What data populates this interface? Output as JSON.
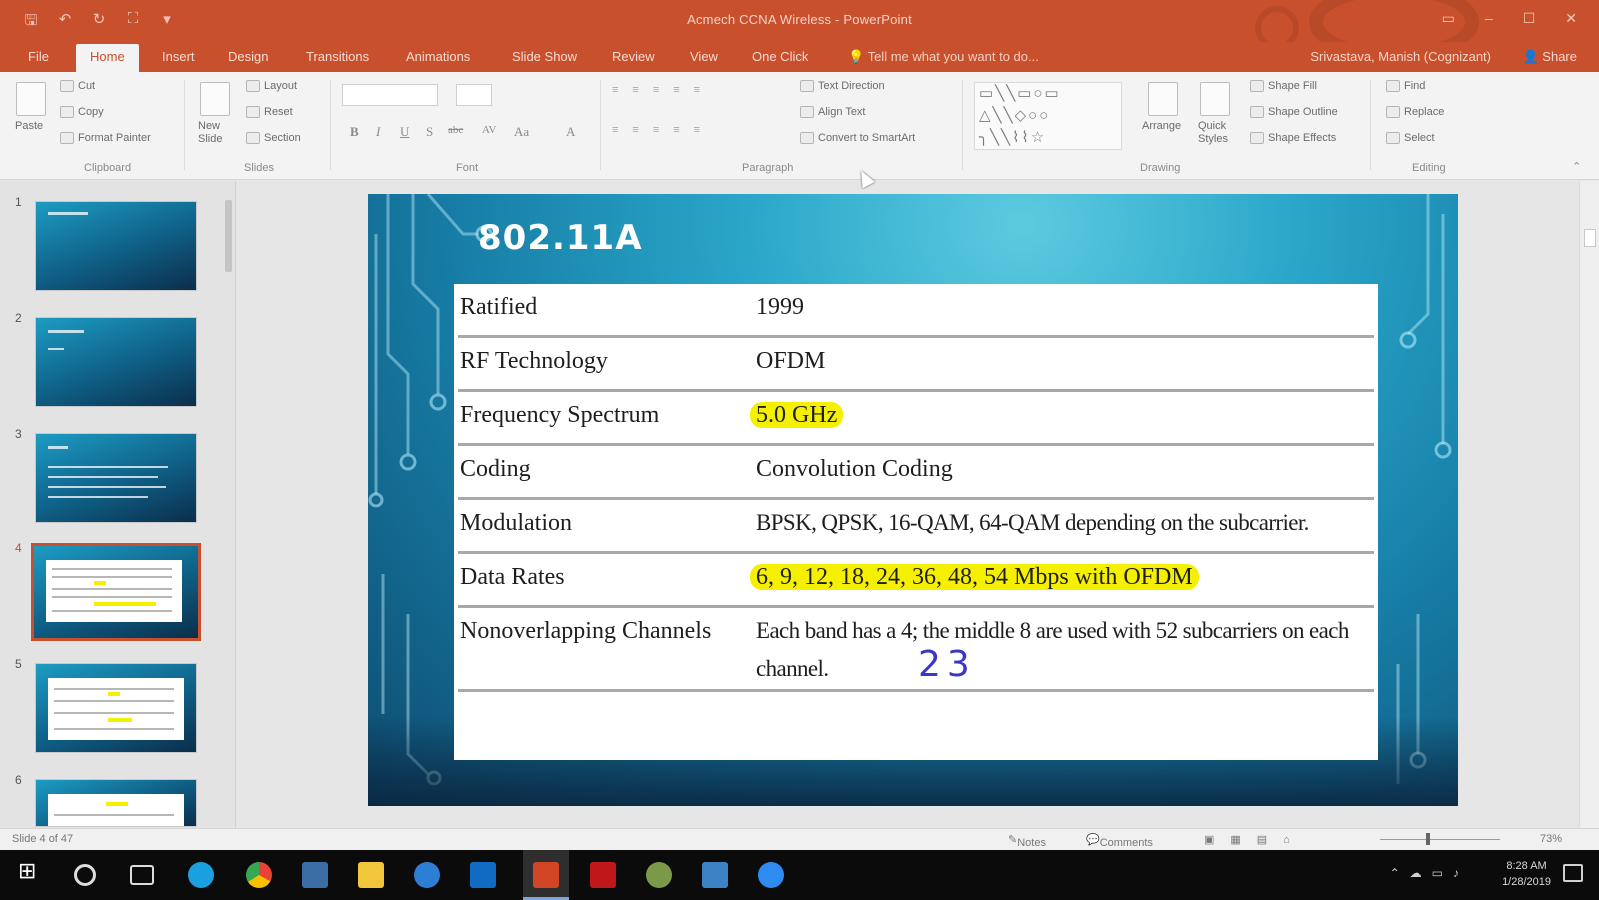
{
  "app": {
    "title": "Acmech CCNA Wireless - PowerPoint",
    "user": "Srivastava, Manish (Cognizant)",
    "share": "Share"
  },
  "qat": {
    "save": "🖫",
    "undo": "↶",
    "redo": "↻",
    "start": "⛶",
    "more": "▾"
  },
  "window_controls": {
    "ribbon_options": "▭",
    "minimize": "–",
    "maximize": "☐",
    "close": "✕"
  },
  "tabs": [
    "File",
    "Home",
    "Insert",
    "Design",
    "Transitions",
    "Animations",
    "Slide Show",
    "Review",
    "View",
    "One Click"
  ],
  "active_tab": "Home",
  "tell_me": "Tell me what you want to do...",
  "ribbon": {
    "clipboard": {
      "paste": "Paste",
      "cut": "Cut",
      "copy": "Copy",
      "format_painter": "Format Painter",
      "label": "Clipboard"
    },
    "slides": {
      "new_slide": "New Slide",
      "layout": "Layout",
      "reset": "Reset",
      "section": "Section",
      "label": "Slides"
    },
    "font": {
      "bold": "B",
      "italic": "I",
      "underline": "U",
      "shadow": "S",
      "strike": "abc",
      "spacing": "AV",
      "case": "Aa",
      "color": "A",
      "label": "Font"
    },
    "paragraph": {
      "text_direction": "Text Direction",
      "align_text": "Align Text",
      "convert_smartart": "Convert to SmartArt",
      "label": "Paragraph"
    },
    "drawing": {
      "arrange": "Arrange",
      "quick_styles": "Quick Styles",
      "shape_fill": "Shape Fill",
      "shape_outline": "Shape Outline",
      "shape_effects": "Shape Effects",
      "label": "Drawing"
    },
    "editing": {
      "find": "Find",
      "replace": "Replace",
      "select": "Select",
      "label": "Editing"
    }
  },
  "thumbnails": [
    "1",
    "2",
    "3",
    "4",
    "5",
    "6"
  ],
  "selected_slide": 4,
  "slide": {
    "title": "802.11A",
    "rows": [
      {
        "label": "Ratified",
        "value": "1999"
      },
      {
        "label": "RF Technology",
        "value": "OFDM"
      },
      {
        "label": "Frequency Spectrum",
        "value": "5.0 GHz"
      },
      {
        "label": "Coding",
        "value": "Convolution Coding"
      },
      {
        "label": "Modulation",
        "value": "BPSK, QPSK, 16-QAM, 64-QAM depending on the subcarrier."
      },
      {
        "label": "Data Rates",
        "value": "6, 9, 12, 18, 24, 36, 48, 54 Mbps with OFDM"
      },
      {
        "label": "Nonoverlapping Channels",
        "value": "Each band has a 4; the middle 8 are used with 52 subcarriers on each channel."
      }
    ],
    "handwriting": "23",
    "highlight_color": "#f5f000"
  },
  "status": {
    "slide_info": "Slide 4 of 47",
    "notes": "Notes",
    "comments": "Comments",
    "zoom": "73%"
  },
  "clock": {
    "time": "8:28 AM",
    "date": "1/28/2019"
  },
  "colors": {
    "accent": "#c8502d",
    "slide_bg": "#2aa6c9",
    "ink": "#3b36c4"
  }
}
